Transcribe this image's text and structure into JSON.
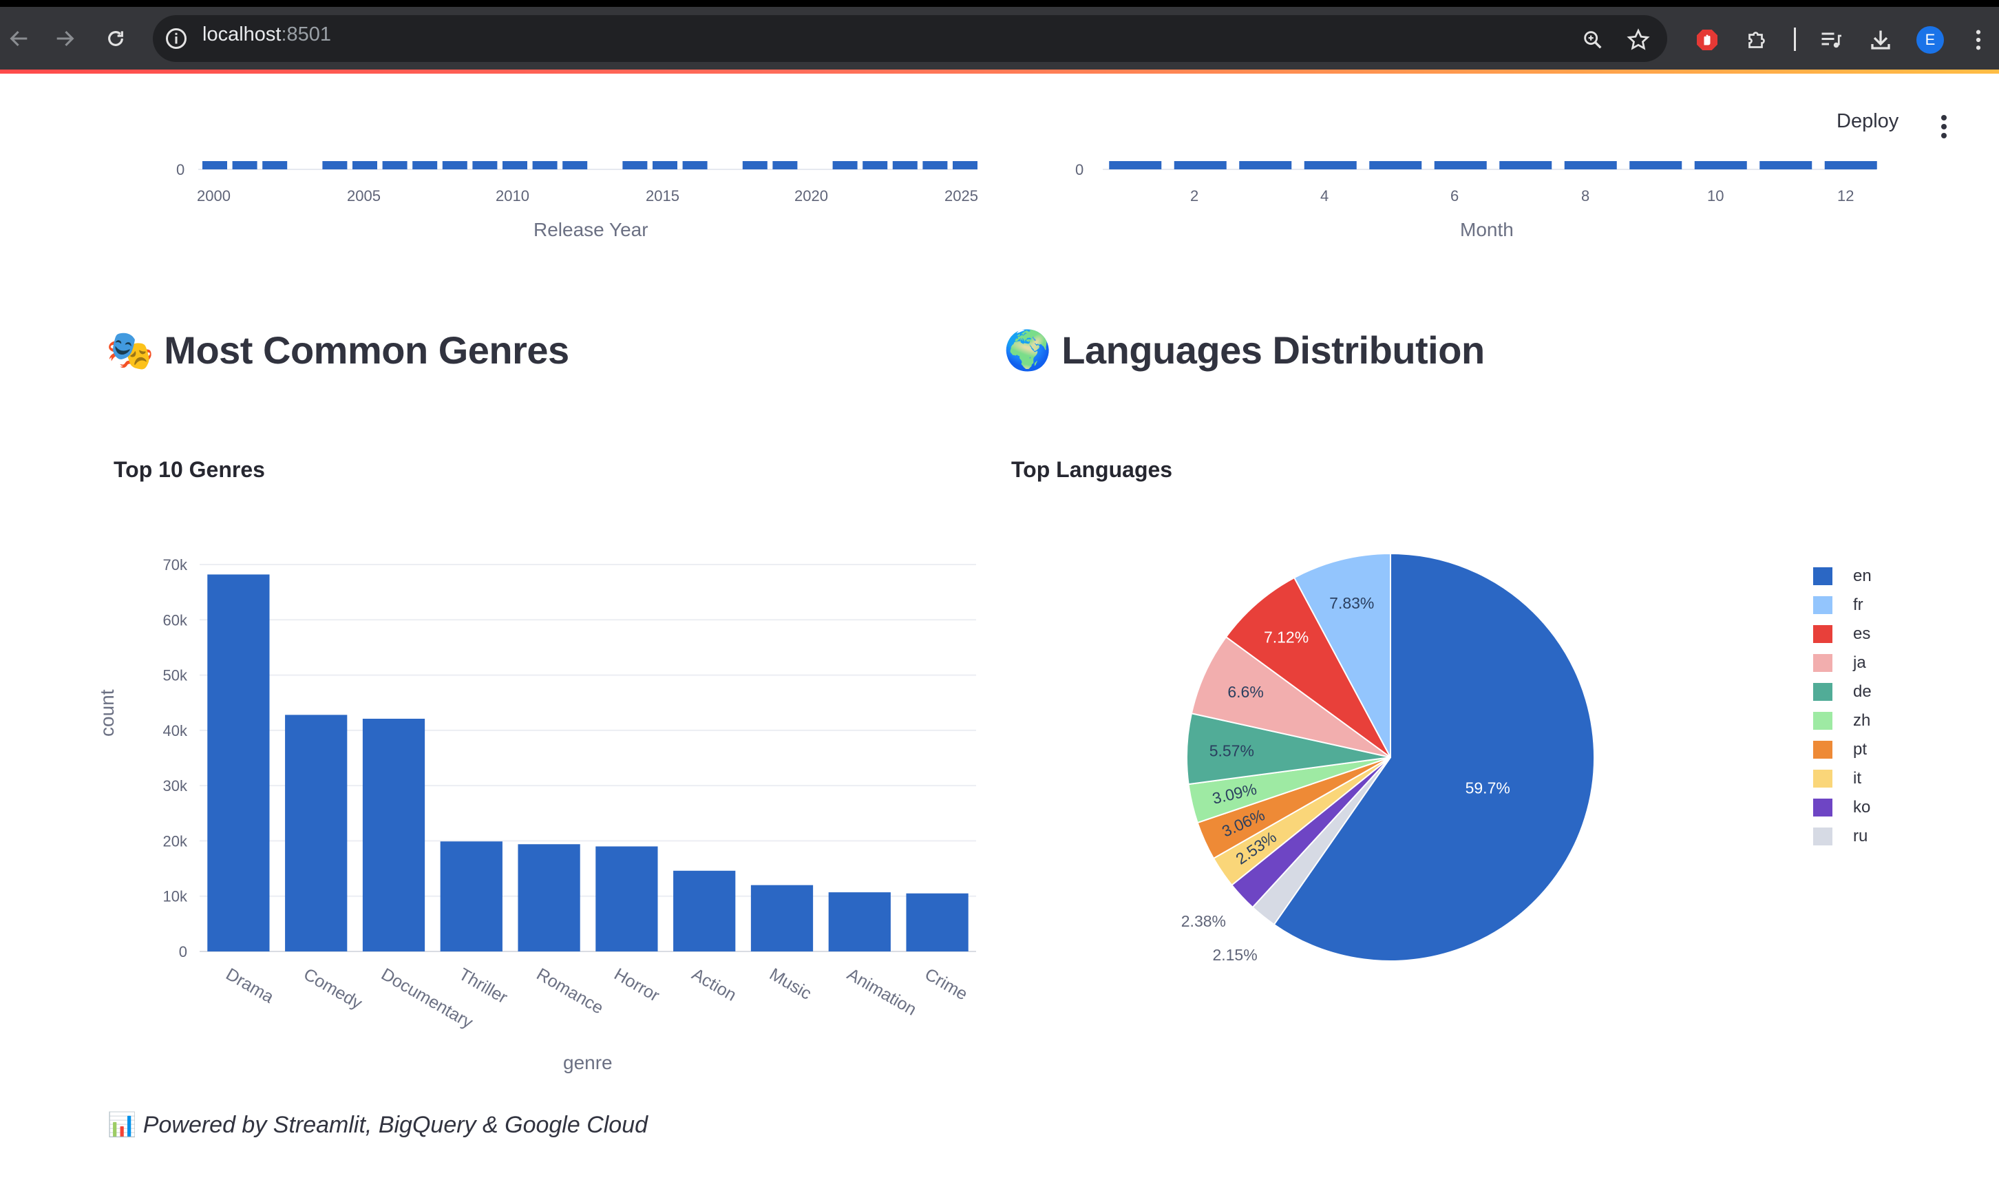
{
  "browser": {
    "url_host": "localhost",
    "url_port": ":8501",
    "profile_initial": "E"
  },
  "header": {
    "deploy_label": "Deploy"
  },
  "top_charts": {
    "left": {
      "y_zero": "0",
      "x_ticks": [
        "2000",
        "2005",
        "2010",
        "2015",
        "2020",
        "2025"
      ],
      "x_title": "Release Year"
    },
    "right": {
      "y_zero": "0",
      "x_ticks": [
        "2",
        "4",
        "6",
        "8",
        "10",
        "12"
      ],
      "x_title": "Month"
    }
  },
  "sections": {
    "genres_title": "Most Common Genres",
    "genres_emoji": "🎭",
    "languages_title": "Languages Distribution",
    "languages_emoji": "🌍"
  },
  "chart_data": [
    {
      "type": "bar",
      "title": "Top 10 Genres",
      "xlabel": "genre",
      "ylabel": "count",
      "categories": [
        "Drama",
        "Comedy",
        "Documentary",
        "Thriller",
        "Romance",
        "Horror",
        "Action",
        "Music",
        "Animation",
        "Crime"
      ],
      "values": [
        68200,
        42800,
        42100,
        19900,
        19400,
        19000,
        14600,
        12000,
        10700,
        10500
      ],
      "ylim": [
        0,
        70000
      ],
      "y_ticks": [
        "0",
        "10k",
        "20k",
        "30k",
        "40k",
        "50k",
        "60k",
        "70k"
      ],
      "color": "#2b67c4",
      "grid": true
    },
    {
      "type": "pie",
      "title": "Top Languages",
      "labels": [
        "en",
        "fr",
        "es",
        "ja",
        "de",
        "zh",
        "pt",
        "it",
        "ko",
        "ru"
      ],
      "values": [
        59.7,
        7.83,
        7.12,
        6.6,
        5.57,
        3.09,
        3.06,
        2.53,
        2.38,
        2.15
      ],
      "value_labels": [
        "59.7%",
        "7.83%",
        "7.12%",
        "6.6%",
        "5.57%",
        "3.09%",
        "3.06%",
        "2.53%",
        "2.38%",
        "2.15%"
      ],
      "colors": [
        "#2b67c4",
        "#93c5fd",
        "#e8403a",
        "#f2aeae",
        "#51ac97",
        "#9eeaa3",
        "#ee8a36",
        "#fad679",
        "#6e45c4",
        "#d6dae4"
      ],
      "legend_position": "right"
    }
  ],
  "footer": {
    "emoji": "📊",
    "text": "Powered by Streamlit, BigQuery & Google Cloud"
  }
}
